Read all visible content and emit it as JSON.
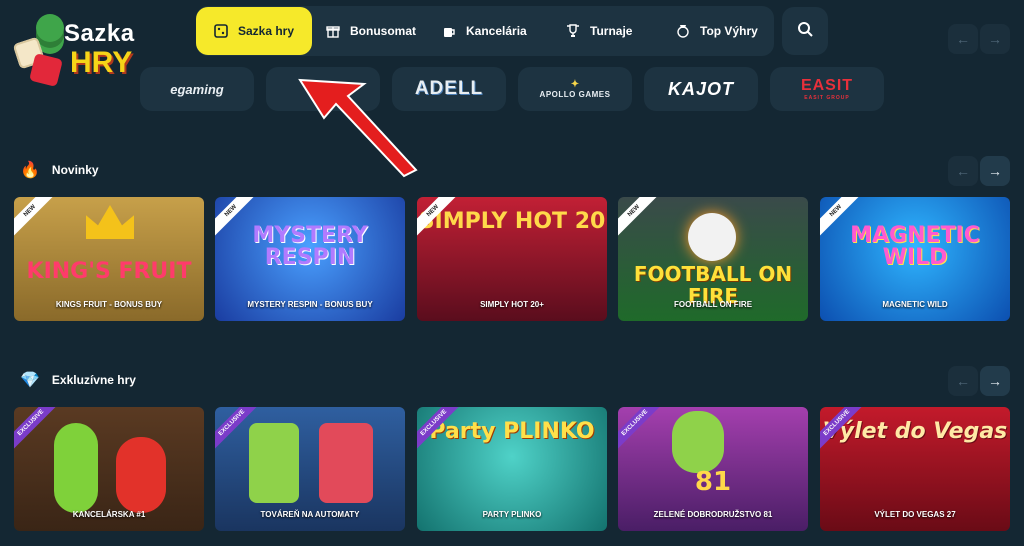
{
  "logo": {
    "line1": "Sazka",
    "line2": "HRY"
  },
  "nav": {
    "items": [
      {
        "label": "Sazka hry",
        "icon": "square-dots-icon",
        "active": true
      },
      {
        "label": "Bonusomat",
        "icon": "gift-icon"
      },
      {
        "label": "Kancelária",
        "icon": "mug-icon"
      },
      {
        "label": "Turnaje",
        "icon": "trophy-icon"
      },
      {
        "label": "Top Výhry",
        "icon": "medal-icon"
      }
    ],
    "search_icon": "search-icon",
    "prev_icon": "←",
    "next_icon": "→"
  },
  "providers": [
    {
      "name": "egaming",
      "color": "#e8eef2"
    },
    {
      "name": "",
      "color": "#e8eef2"
    },
    {
      "name": "ADELL",
      "color": "#e8eef2"
    },
    {
      "name": "APOLLO GAMES",
      "color": "#e8eef2"
    },
    {
      "name": "KAJOT",
      "color": "#ffffff"
    },
    {
      "name": "EASIT",
      "sub": "EASIT GROUP",
      "color": "#e8303b"
    }
  ],
  "sections": [
    {
      "title": "Novinky",
      "icon": "flame-icon",
      "emoji": "🔥",
      "games": [
        {
          "title": "KING'S FRUIT",
          "caption": "KINGS FRUIT - BONUS BUY",
          "ribbon": "NEW",
          "bg": "linear-gradient(180deg,#c7a04a,#8a6a2a)",
          "title_color": "#ff3b6b"
        },
        {
          "title": "MYSTERY RESPIN",
          "caption": "MYSTERY RESPIN - BONUS BUY",
          "ribbon": "NEW",
          "bg": "radial-gradient(circle at 50% 40%,#4aa0ff,#1a3ca0)",
          "title_color": "#b17bff"
        },
        {
          "title": "SIMPLY HOT 20",
          "caption": "SIMPLY HOT 20+",
          "ribbon": "NEW",
          "bg": "linear-gradient(180deg,#c22035,#5a0d1d)",
          "title_color": "#ffd94a"
        },
        {
          "title": "FOOTBALL ON FIRE",
          "caption": "FOOTBALL ON FIRE",
          "ribbon": "NEW",
          "bg": "linear-gradient(180deg,#3a4a4a,#1f6a2a)",
          "title_color": "#ffe13a"
        },
        {
          "title": "MAGNETIC WILD",
          "caption": "MAGNETIC WILD",
          "ribbon": "NEW",
          "bg": "radial-gradient(circle at 50% 40%,#2fb5ff,#0c4fb0)",
          "title_color": "#ff5ad0"
        }
      ]
    },
    {
      "title": "Exkluzívne hry",
      "icon": "diamond-icon",
      "emoji": "💎",
      "games": [
        {
          "title": "",
          "caption": "KANCELÁRSKA #1",
          "ribbon": "EXCLUSIVE",
          "bg": "linear-gradient(180deg,#5a3a22,#3a2516)",
          "title_color": "#ffffff"
        },
        {
          "title": "",
          "caption": "TOVÁREŇ NA AUTOMATY",
          "ribbon": "EXCLUSIVE",
          "bg": "linear-gradient(180deg,#2f5fa0,#1a3560)",
          "title_color": "#ffffff"
        },
        {
          "title": "Party PLINKO",
          "caption": "PARTY PLINKO",
          "ribbon": "EXCLUSIVE",
          "bg": "radial-gradient(circle at 50% 40%,#4fd2c8,#13726e)",
          "title_color": "#ffe04a"
        },
        {
          "title": "81",
          "caption": "ZELENÉ DOBRODRUŽSTVO 81",
          "ribbon": "EXCLUSIVE",
          "bg": "linear-gradient(180deg,#a43fae,#4a1e66)",
          "title_color": "#ffd84a"
        },
        {
          "title": "Výlet do Vegas",
          "caption": "VÝLET DO VEGAS 27",
          "ribbon": "EXCLUSIVE",
          "bg": "linear-gradient(180deg,#c31a2b,#6a0b16)",
          "title_color": "#ffe9a6"
        }
      ]
    }
  ]
}
